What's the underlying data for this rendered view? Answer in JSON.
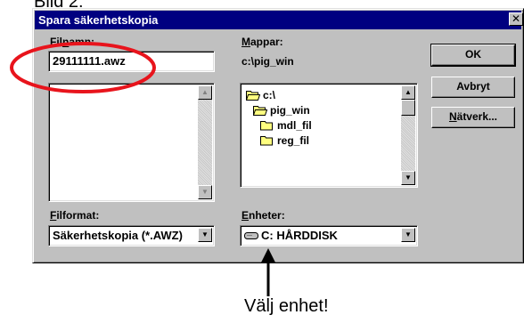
{
  "top_caption": "Bild 2:",
  "dialog": {
    "title": "Spara säkerhetskopia",
    "close_glyph": "✕",
    "filename": {
      "label_pre": "Fil",
      "label_key": "n",
      "label_post": "amn:",
      "value": "29111111.awz"
    },
    "folders": {
      "label_key": "M",
      "label_post": "appar:",
      "current_path": "c:\\pig_win",
      "tree": [
        {
          "name": "c:\\",
          "icon": "open-folder-icon"
        },
        {
          "name": "pig_win",
          "icon": "open-folder-icon"
        },
        {
          "name": "mdl_fil",
          "icon": "folder-icon"
        },
        {
          "name": "reg_fil",
          "icon": "folder-icon"
        }
      ]
    },
    "buttons": {
      "ok": "OK",
      "cancel": "Avbryt",
      "network_key": "N",
      "network_post": "ätverk..."
    },
    "file_format": {
      "label_key": "F",
      "label_post": "ilformat:",
      "value": "Säkerhetskopia (*.AWZ)"
    },
    "drives": {
      "label_key": "E",
      "label_post": "nheter:",
      "value": "C: HÅRDDISK",
      "icon": "hard-drive-icon"
    }
  },
  "bottom_caption": "Välj enhet!",
  "colors": {
    "titlebar": "#000080",
    "dialog_bg": "#c0c0c0",
    "highlight_ellipse": "#e8141c",
    "folder_yellow": "#ffff80"
  }
}
